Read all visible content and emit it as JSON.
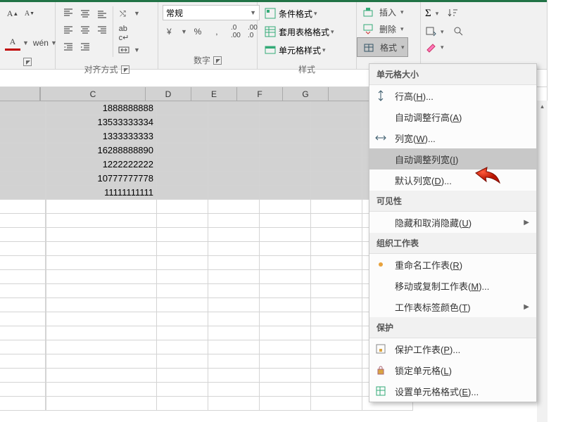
{
  "ribbon": {
    "groups": {
      "font": {
        "label": ""
      },
      "align": {
        "label": "对齐方式",
        "normal": "常规",
        "wen": "wén"
      },
      "number": {
        "label": "数字"
      },
      "styles": {
        "label": "样式",
        "cond": "条件格式",
        "table": "套用表格格式",
        "cell": "单元格样式"
      },
      "cells": {
        "insert": "插入",
        "delete": "删除",
        "format": "格式"
      },
      "editing": {}
    }
  },
  "columns": {
    "a": "",
    "c": "C",
    "d": "D",
    "e": "E",
    "f": "F",
    "g": "G",
    "h": ""
  },
  "data_rows": [
    "1888888888",
    "13533333334",
    "1333333333",
    "16288888890",
    "1222222222",
    "10777777778",
    "11111111111"
  ],
  "menu": {
    "sec1": "单元格大小",
    "row_height": "行高(",
    "row_height_u": "H",
    "row_height_end": ")...",
    "autofit_row": "自动调整行高(",
    "autofit_row_u": "A",
    "autofit_row_end": ")",
    "col_width": "列宽(",
    "col_width_u": "W",
    "col_width_end": ")...",
    "autofit_col": "自动调整列宽(",
    "autofit_col_u": "I",
    "autofit_col_end": ")",
    "default_w": "默认列宽(",
    "default_w_u": "D",
    "default_w_end": ")...",
    "sec2": "可见性",
    "hide": "隐藏和取消隐藏(",
    "hide_u": "U",
    "hide_end": ")",
    "sec3": "组织工作表",
    "rename": "重命名工作表(",
    "rename_u": "R",
    "rename_end": ")",
    "move": "移动或复制工作表(",
    "move_u": "M",
    "move_end": ")...",
    "tabcolor": "工作表标签颜色(",
    "tabcolor_u": "T",
    "tabcolor_end": ")",
    "sec4": "保护",
    "protect": "保护工作表(",
    "protect_u": "P",
    "protect_end": ")...",
    "lock": "锁定单元格(",
    "lock_u": "L",
    "lock_end": ")",
    "format_cells": "设置单元格格式(",
    "format_cells_u": "E",
    "format_cells_end": ")..."
  }
}
